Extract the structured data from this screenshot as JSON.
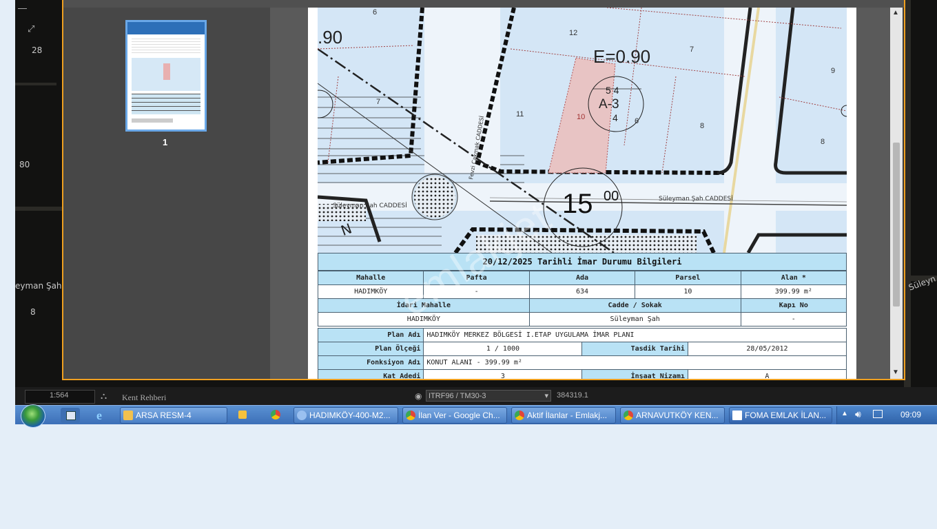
{
  "map_background": {
    "tools": {
      "zoom_level_label": "28",
      "coord_label": "80",
      "street_label": "eyman Şah",
      "small_num": "8",
      "right_label": "Süleyn"
    },
    "status": {
      "scale": "1:564",
      "module": "Kent Rehberi",
      "projection": "ITRF96 / TM30-3",
      "coordinate": "384319.1"
    }
  },
  "viewer": {
    "thumbnail_page_number": "1"
  },
  "map_drawing": {
    "floor_ratio_top": "E=0.90",
    "floor_ratio_left": ".90",
    "zone_code": "A-3",
    "zone_top": "5 4",
    "zone_bottom": "4",
    "road_width": "15",
    "road_width_sup": "00",
    "street_right": "Süleyman Şah CADDESİ",
    "street_left": "Süleyman Şah CADDESİ",
    "street_vertical": "Fevzi Çakmak CADDESİ",
    "parcel_numbers": [
      "6",
      "12",
      "7",
      "9",
      "7",
      "11",
      "10",
      "8",
      "8",
      "6"
    ]
  },
  "info": {
    "title": "20/12/2025 Tarihli İmar Durumu Bilgileri",
    "row1_headers": [
      "Mahalle",
      "Pafta",
      "Ada",
      "Parsel",
      "Alan *"
    ],
    "row1_values": [
      "HADIMKÖY",
      "-",
      "634",
      "10",
      "399.99 m²"
    ],
    "row2_headers": [
      "İdari Mahalle",
      "Cadde / Sokak",
      "Kapı No"
    ],
    "row2_values": [
      "HADIMKÖY",
      "Süleyman Şah",
      "-"
    ],
    "plan_adi_label": "Plan Adı",
    "plan_adi_value": "HADIMKÖY MERKEZ BÖLGESİ I.ETAP UYGULAMA İMAR PLANI",
    "plan_olcegi_label": "Plan Ölçeği",
    "plan_olcegi_value": "1 / 1000",
    "tasdik_label": "Tasdik Tarihi",
    "tasdik_value": "28/05/2012",
    "fonksiyon_label": "Fonksiyon Adı",
    "fonksiyon_value": "KONUT ALANI  - 399.99 m²",
    "kat_label": "Kat Adedi",
    "kat_value": "3",
    "insaat_label": "İnşaat Nizamı",
    "insaat_value": "A"
  },
  "watermark": "emlakjet",
  "taskbar": {
    "items": [
      {
        "label": "ARSA RESM-4",
        "color": "#f2c14e"
      },
      {
        "label": "HADIMKÖY-400-M2...",
        "color": "#9ac0f0"
      },
      {
        "label": "İlan Ver - Google Ch...",
        "color": "#e0453a"
      },
      {
        "label": "Aktif İlanlar - Emlakj...",
        "color": "#e0453a"
      },
      {
        "label": "ARNAVUTKÖY KEN...",
        "color": "#e0453a"
      },
      {
        "label": "FOMA EMLAK İLAN...",
        "color": "#ffffff"
      }
    ],
    "clock": "09:09"
  }
}
